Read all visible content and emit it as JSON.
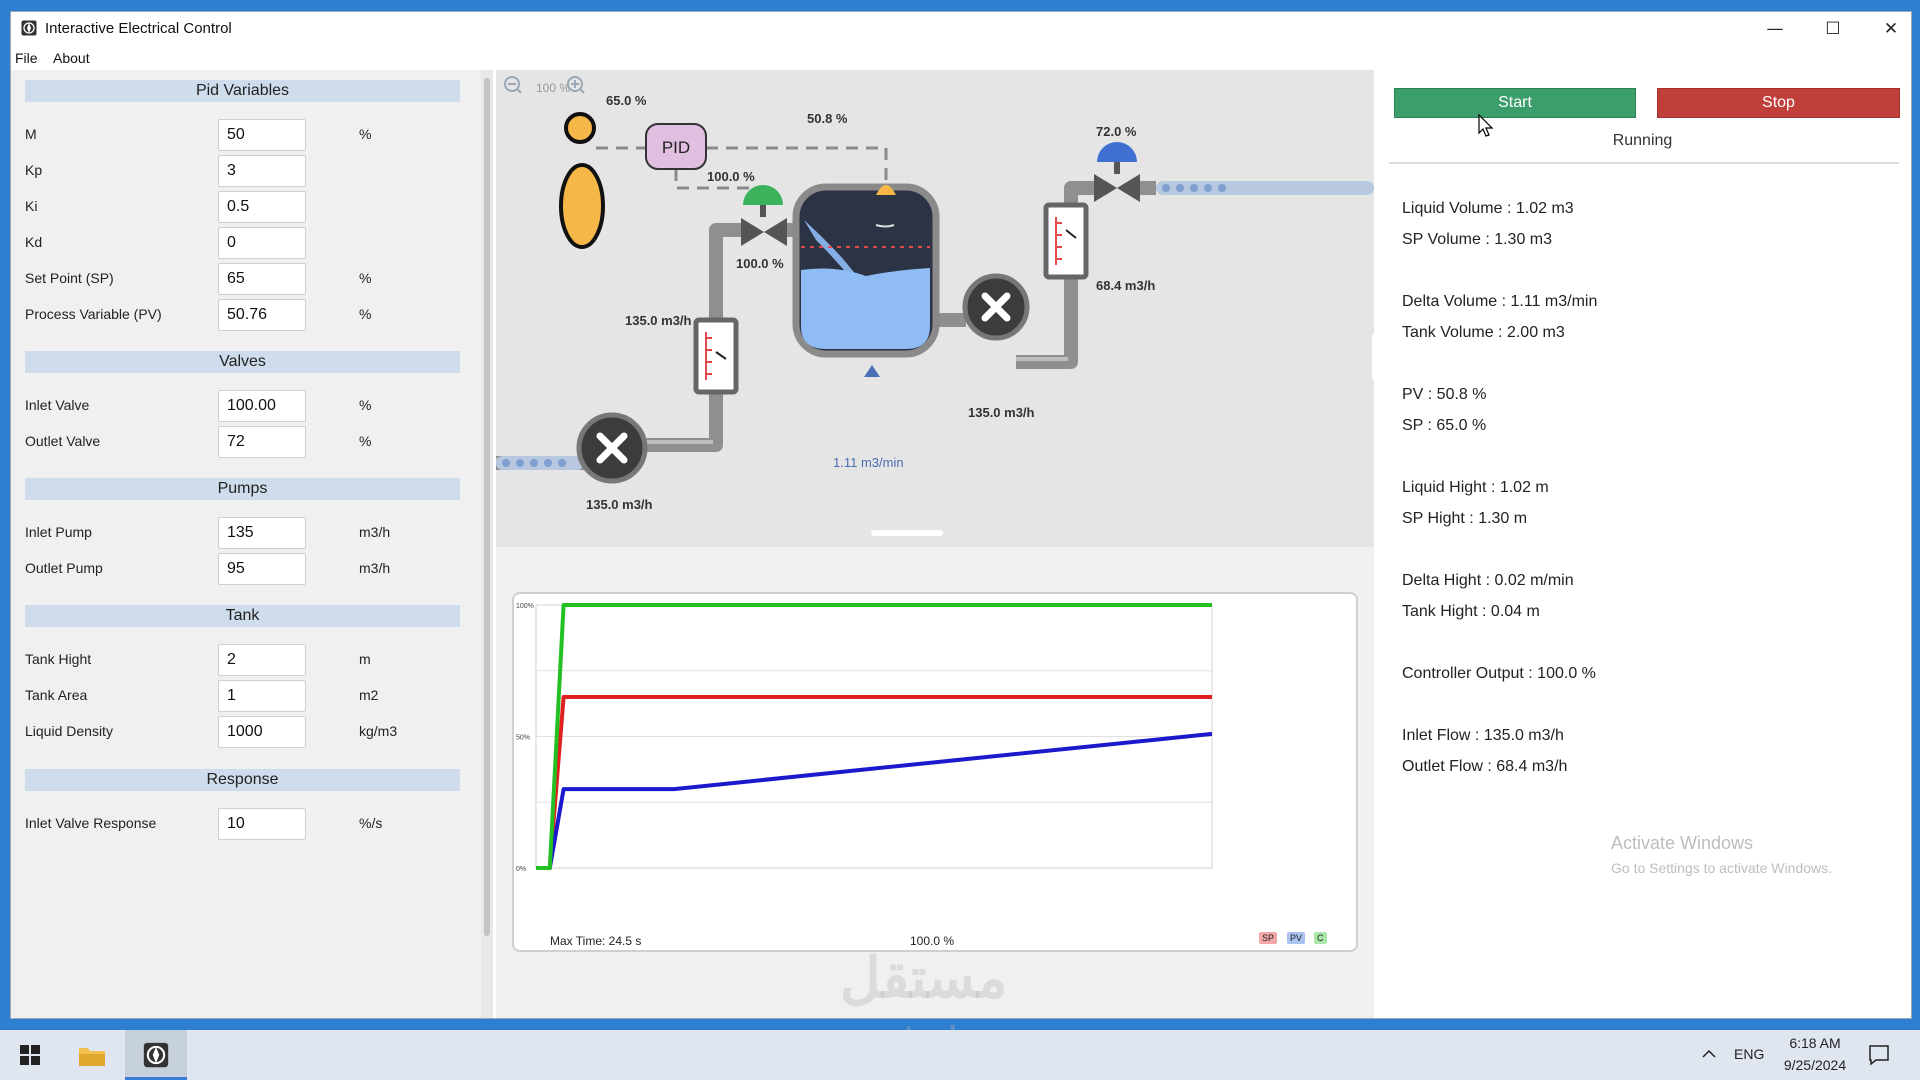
{
  "window": {
    "title": "Interactive Electrical Control",
    "controls": {
      "minimize": "—",
      "maximize": "☐",
      "close": "✕"
    }
  },
  "menu": [
    "File",
    "About"
  ],
  "left": {
    "pid_header": "Pid Variables",
    "valves_header": "Valves",
    "pumps_header": "Pumps",
    "tank_header": "Tank",
    "response_header": "Response",
    "fields": {
      "m": {
        "label": "M",
        "value": "50",
        "unit": "%"
      },
      "kp": {
        "label": "Kp",
        "value": "3",
        "unit": ""
      },
      "ki": {
        "label": "Ki",
        "value": "0.5",
        "unit": ""
      },
      "kd": {
        "label": "Kd",
        "value": "0",
        "unit": ""
      },
      "sp": {
        "label": "Set Point (SP)",
        "value": "65",
        "unit": "%"
      },
      "pv": {
        "label": "Process Variable (PV)",
        "value": "50.76",
        "unit": "%"
      },
      "inlet_valve": {
        "label": "Inlet Valve",
        "value": "100.00",
        "unit": "%"
      },
      "outlet_valve": {
        "label": "Outlet Valve",
        "value": "72",
        "unit": "%"
      },
      "inlet_pump": {
        "label": "Inlet Pump",
        "value": "135",
        "unit": "m3/h"
      },
      "outlet_pump": {
        "label": "Outlet Pump",
        "value": "95",
        "unit": "m3/h"
      },
      "tank_hight": {
        "label": "Tank Hight",
        "value": "2",
        "unit": "m"
      },
      "tank_area": {
        "label": "Tank Area",
        "value": "1",
        "unit": "m2"
      },
      "liquid_density": {
        "label": "Liquid Density",
        "value": "1000",
        "unit": "kg/m3"
      },
      "inlet_valve_response": {
        "label": "Inlet Valve Response",
        "value": "10",
        "unit": "%/s"
      }
    }
  },
  "diagram": {
    "zoom": "100 %",
    "pid_label": "PID",
    "labels": {
      "person_value": "65.0 %",
      "pid_out": "100.0 %",
      "level": "50.8 %",
      "inlet_valve": "100.0 %",
      "inlet_flow_meter": "135.0 m3/h",
      "inlet_pump": "135.0 m3/h",
      "outlet_pump": "135.0 m3/h",
      "outlet_valve": "72.0 %",
      "outlet_flow_meter": "68.4 m3/h",
      "tank_rate": "1.11 m3/min"
    }
  },
  "chart_data": {
    "type": "line",
    "ylim": [
      0,
      100
    ],
    "ytick_labels": [
      "100%",
      "50%",
      "0%"
    ],
    "footer_left": "Max Time: 24.5 s",
    "footer_center": "100.0 %",
    "series": [
      {
        "name": "SP",
        "color": "#e02020",
        "points": [
          [
            0,
            0
          ],
          [
            0.5,
            0
          ],
          [
            1,
            65
          ],
          [
            24.5,
            65
          ]
        ]
      },
      {
        "name": "PV",
        "color": "#1a1acc",
        "points": [
          [
            0,
            0
          ],
          [
            0.5,
            0
          ],
          [
            1,
            30
          ],
          [
            5,
            30
          ],
          [
            24.5,
            51
          ]
        ]
      },
      {
        "name": "C",
        "color": "#22c022",
        "points": [
          [
            0,
            0
          ],
          [
            0.5,
            0
          ],
          [
            1,
            100
          ],
          [
            24.5,
            100
          ]
        ]
      }
    ],
    "x_range": [
      0,
      24.5
    ],
    "grid": true
  },
  "right": {
    "start_label": "Start",
    "stop_label": "Stop",
    "status": "Running",
    "info": {
      "liquid_volume": "Liquid Volume : 1.02 m3",
      "sp_volume": "SP Volume : 1.30 m3",
      "delta_volume": "Delta Volume : 1.11 m3/min",
      "tank_volume": "Tank Volume : 2.00 m3",
      "pv": "PV : 50.8 %",
      "sp": "SP : 65.0 %",
      "liquid_hight": "Liquid Hight : 1.02 m",
      "sp_hight": "SP Hight : 1.30 m",
      "delta_hight": "Delta Hight : 0.02 m/min",
      "tank_hight": "Tank Hight : 0.04 m",
      "controller_output": "Controller Output : 100.0 %",
      "inlet_flow": "Inlet Flow : 135.0 m3/h",
      "outlet_flow": "Outlet Flow : 68.4 m3/h"
    },
    "activate_title": "Activate Windows",
    "activate_sub": "Go to Settings to activate Windows."
  },
  "taskbar": {
    "lang": "ENG",
    "time": "6:18 AM",
    "date": "9/25/2024"
  },
  "watermark": {
    "arabic": "مستقل",
    "latin": "mostaql.com"
  },
  "colors": {
    "start": "#3c9e6a",
    "stop": "#c13f3b",
    "section": "#cfdceb",
    "accent": "#3a7bd5"
  }
}
